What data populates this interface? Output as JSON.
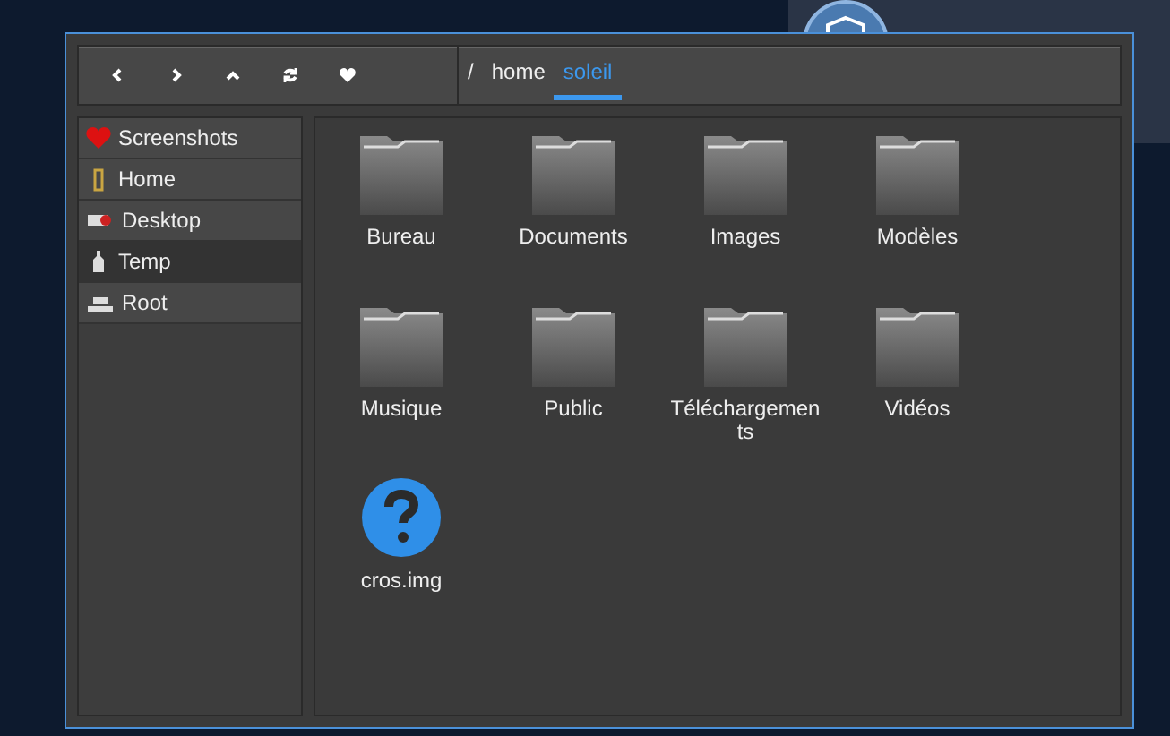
{
  "breadcrumb": [
    {
      "label": "/",
      "selected": false
    },
    {
      "label": "home",
      "selected": false
    },
    {
      "label": "soleil",
      "selected": true
    }
  ],
  "sidebar": {
    "items": [
      {
        "label": "Screenshots",
        "selected": false
      },
      {
        "label": "Home",
        "selected": false
      },
      {
        "label": "Desktop",
        "selected": false
      },
      {
        "label": "Temp",
        "selected": true
      },
      {
        "label": "Root",
        "selected": false
      }
    ]
  },
  "files": [
    {
      "name": "Bureau",
      "kind": "folder"
    },
    {
      "name": "Documents",
      "kind": "folder"
    },
    {
      "name": "Images",
      "kind": "folder"
    },
    {
      "name": "Modèles",
      "kind": "folder"
    },
    {
      "name": "Musique",
      "kind": "folder"
    },
    {
      "name": "Public",
      "kind": "folder"
    },
    {
      "name": "Téléchargements",
      "kind": "folder"
    },
    {
      "name": "Vidéos",
      "kind": "folder"
    },
    {
      "name": "cros.img",
      "kind": "unknown"
    }
  ]
}
